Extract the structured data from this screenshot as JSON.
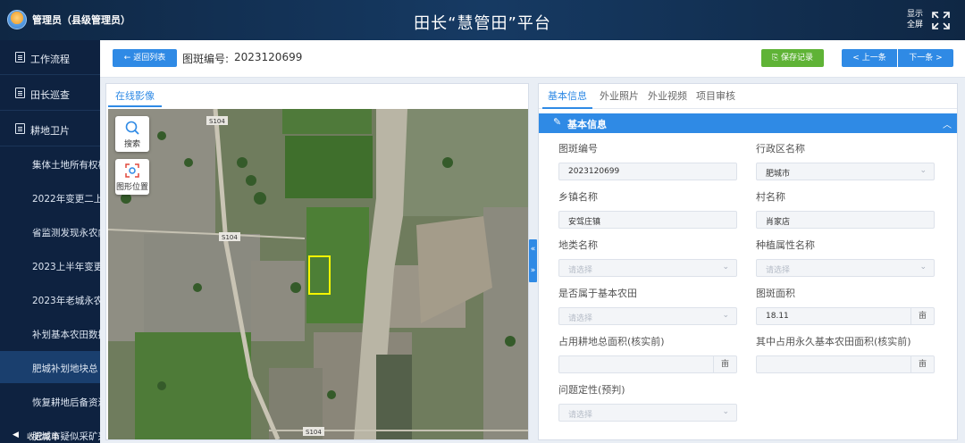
{
  "header": {
    "user": "管理员（县级管理员）",
    "title": "田长“慧管田”平台",
    "fullscreen_label": "显示\n全屏"
  },
  "sidebar": {
    "items": [
      {
        "label": "工作流程"
      },
      {
        "label": "田长巡查"
      },
      {
        "label": "耕地卫片"
      }
    ],
    "subitems": [
      {
        "label": "集体土地所有权核"
      },
      {
        "label": "2022年变更二上未"
      },
      {
        "label": "省监测发现永农内"
      },
      {
        "label": "2023上半年变更调"
      },
      {
        "label": "2023年老城永农内"
      },
      {
        "label": "补划基本农田数据"
      },
      {
        "label": "肥城补划地块总"
      },
      {
        "label": "恢复耕地后备资源"
      },
      {
        "label": "肥城市疑似采矿采"
      }
    ],
    "active_index": 6,
    "collapse_label": "收起菜单"
  },
  "toolbar": {
    "back_label": "← 返回列表",
    "id_label": "图斑编号:",
    "id_value": "2023120699",
    "save_label": "保存记录",
    "prev_label": "<  上一条",
    "next_label": "下一条  >"
  },
  "map": {
    "tab_label": "在线影像",
    "tools": [
      {
        "label": "搜索",
        "icon": "search-icon"
      },
      {
        "label": "图形位置",
        "icon": "locate-icon"
      }
    ],
    "road_labels": [
      "S104",
      "S104",
      "S104"
    ]
  },
  "form": {
    "tabs": [
      "基本信息",
      "外业照片",
      "外业视频",
      "项目审核"
    ],
    "active_tab": 0,
    "section_title": "基本信息",
    "fields": [
      {
        "label": "图斑编号",
        "value": "2023120699",
        "type": "text"
      },
      {
        "label": "行政区名称",
        "value": "肥城市",
        "type": "select"
      },
      {
        "label": "乡镇名称",
        "value": "安驾庄镇",
        "type": "text"
      },
      {
        "label": "村名称",
        "value": "肖家店",
        "type": "text"
      },
      {
        "label": "地类名称",
        "value": "",
        "placeholder": "请选择",
        "type": "select"
      },
      {
        "label": "种植属性名称",
        "value": "",
        "placeholder": "请选择",
        "type": "select"
      },
      {
        "label": "是否属于基本农田",
        "value": "",
        "placeholder": "请选择",
        "type": "select"
      },
      {
        "label": "图斑面积",
        "value": "18.11",
        "unit": "亩",
        "type": "unit"
      },
      {
        "label": "占用耕地总面积(核实前)",
        "value": "",
        "unit": "亩",
        "type": "unit"
      },
      {
        "label": "其中占用永久基本农田面积(核实前)",
        "value": "",
        "unit": "亩",
        "type": "unit"
      },
      {
        "label": "问题定性(预判)",
        "value": "",
        "placeholder": "请选择",
        "type": "select"
      }
    ]
  },
  "colors": {
    "accent": "#2f8ae5",
    "save": "#5fb336",
    "sidebar": "#0e2240",
    "header": "#163a63",
    "highlight_polygon": "#f5f500"
  }
}
